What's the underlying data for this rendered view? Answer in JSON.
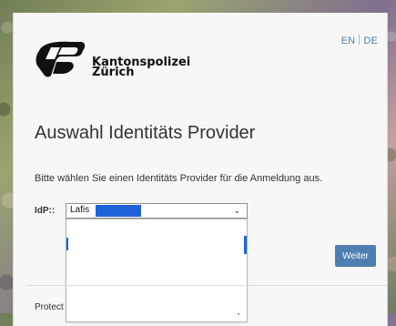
{
  "language": {
    "options": [
      "EN",
      "DE"
    ]
  },
  "logo": {
    "line1": "Kantonspolizei",
    "line2": "Zürich"
  },
  "main": {
    "title": "Auswahl Identitäts Provider",
    "instruction": "Bitte wählen Sie einen Identitäts Provider für die Anmeldung aus.",
    "idp_label": "IdP::",
    "selected_idp": "Lafis",
    "submit": "Weiter",
    "footer_text": "Protect"
  },
  "colors": {
    "accent": "#4f7fb0",
    "highlight": "#1e63d9",
    "link": "#4d7fa8"
  }
}
